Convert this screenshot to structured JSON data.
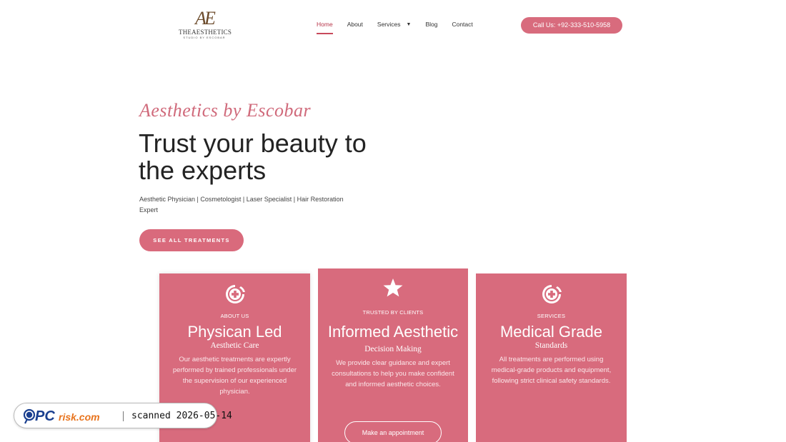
{
  "header": {
    "logo": {
      "mark": "AE",
      "name": "THEAESTHETICS",
      "sub": "STUDIO BY ESCOBAR"
    },
    "nav": [
      {
        "label": "Home",
        "active": true
      },
      {
        "label": "About",
        "active": false
      },
      {
        "label": "Services",
        "active": false,
        "has_dropdown": true
      },
      {
        "label": "Blog",
        "active": false
      },
      {
        "label": "Contact",
        "active": false
      }
    ],
    "call_button": "Call Us: +92-333-510-5958"
  },
  "hero": {
    "script_title": "Aesthetics by Escobar",
    "headline": "Trust your beauty to the experts",
    "subtitle": "Aesthetic Physician | Cosmetologist | Laser Specialist | Hair Restoration Expert",
    "cta": "SEE ALL TREATMENTS"
  },
  "cards": [
    {
      "icon": "medical-cross-icon",
      "eyebrow": "ABOUT US",
      "title": "Physican Led",
      "subtitle": "Aesthetic Care",
      "text": "Our aesthetic treatments are expertly performed by trained professionals under the supervision of our experienced physician."
    },
    {
      "icon": "star-icon",
      "eyebrow": "TRUSTED BY CLIENTS",
      "title": "Informed Aesthetic",
      "subtitle": "Decision Making",
      "text": "We provide clear guidance and expert consultations to help you make confident and informed aesthetic choices.",
      "button": "Make an appointment"
    },
    {
      "icon": "medical-cross-icon",
      "eyebrow": "SERVICES",
      "title": "Medical Grade",
      "subtitle": "Standards",
      "text": "All treatments are performed using medical-grade products and equipment, following strict clinical safety standards."
    }
  ],
  "watermark": {
    "brand": "PCrisk.com",
    "text": "scanned 2026-05-14"
  },
  "colors": {
    "accent": "#d86b7d",
    "script": "#d06a7b",
    "nav_active": "#b8374b"
  }
}
